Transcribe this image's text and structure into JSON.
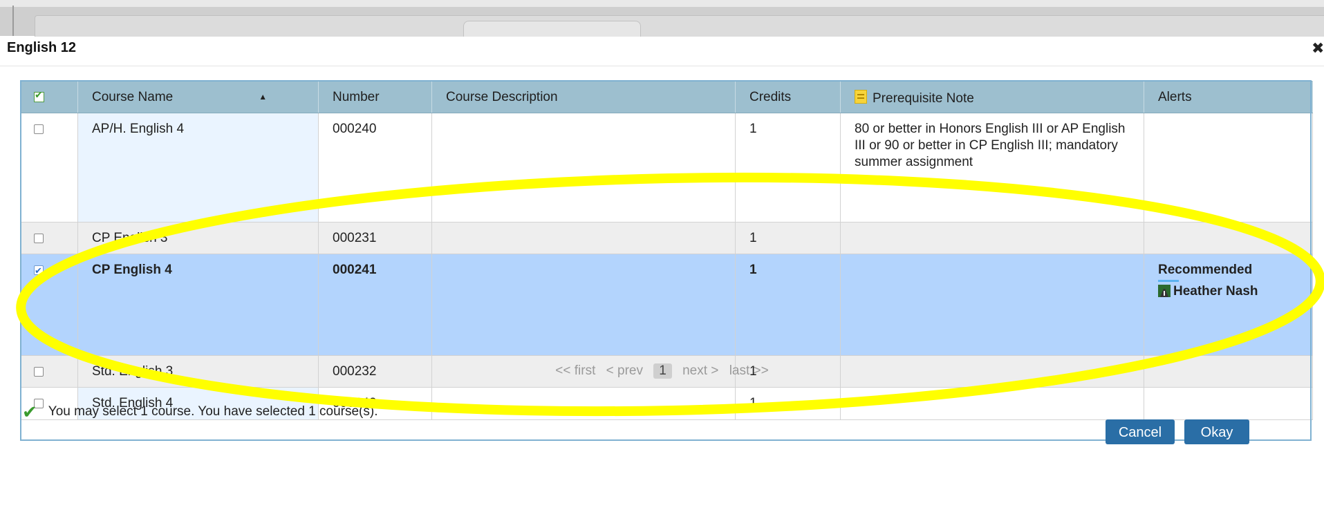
{
  "dialog": {
    "title": "English 12",
    "close_label": "✖"
  },
  "table": {
    "columns": [
      "Course Name",
      "Number",
      "Course Description",
      "Credits",
      "Prerequisite Note",
      "Alerts"
    ],
    "rows": [
      {
        "name": "AP/H. English 4",
        "number": "000240",
        "description": "",
        "credits": "1",
        "prereq": "80 or better in Honors English III or AP English III or 90 or better in CP English III; mandatory summer assignment",
        "alert_title": "",
        "alert_person": ""
      },
      {
        "name": "CP English 3",
        "number": "000231",
        "description": "",
        "credits": "1",
        "prereq": "",
        "alert_title": "",
        "alert_person": ""
      },
      {
        "name": "CP English 4",
        "number": "000241",
        "description": "",
        "credits": "1",
        "prereq": "",
        "alert_title": "Recommended",
        "alert_person": "Heather Nash"
      },
      {
        "name": "Std. English 3",
        "number": "000232",
        "description": "",
        "credits": "1",
        "prereq": "",
        "alert_title": "",
        "alert_person": ""
      },
      {
        "name": "Std. English 4",
        "number": "000242",
        "description": "",
        "credits": "1",
        "prereq": "",
        "alert_title": "",
        "alert_person": ""
      }
    ]
  },
  "pager": {
    "first": "<< first",
    "prev": "< prev",
    "current": "1",
    "next": "next >",
    "last": "last >>"
  },
  "status": {
    "message": "You may select 1 course.  You have selected 1 course(s)."
  },
  "buttons": {
    "cancel": "Cancel",
    "okay": "Okay"
  },
  "colors": {
    "header_bg": "#9dbfcf",
    "selected_row": "#b3d4fd",
    "button": "#2a6ea6",
    "highlight": "#ffff00"
  }
}
